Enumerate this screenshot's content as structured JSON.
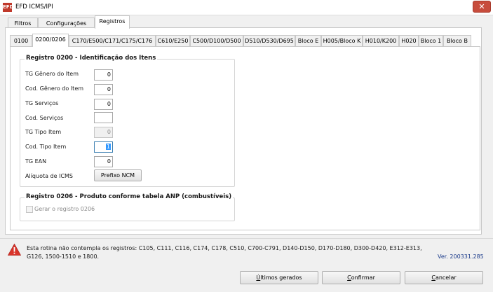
{
  "window": {
    "app_icon_text": "EFD",
    "title": "EFD ICMS/IPI",
    "close_glyph": "✕"
  },
  "top_tabs": [
    {
      "label": "Filtros",
      "active": false
    },
    {
      "label": "Configurações",
      "active": false
    },
    {
      "label": "Registros",
      "active": true
    }
  ],
  "inner_tabs": [
    {
      "label": "0100",
      "active": false
    },
    {
      "label": "0200/0206",
      "active": true
    },
    {
      "label": "C170/E500/C171/C175/C176",
      "active": false
    },
    {
      "label": "C610/E250",
      "active": false
    },
    {
      "label": "C500/D100/D500",
      "active": false
    },
    {
      "label": "D510/D530/D695",
      "active": false
    },
    {
      "label": "Bloco E",
      "active": false
    },
    {
      "label": "H005/Bloco K",
      "active": false
    },
    {
      "label": "H010/K200",
      "active": false
    },
    {
      "label": "H020",
      "active": false
    },
    {
      "label": "Bloco 1",
      "active": false
    },
    {
      "label": "Bloco B",
      "active": false
    }
  ],
  "group_0200": {
    "title": "Registro 0200 - Identificação dos Itens",
    "fields": [
      {
        "label": "TG Gênero do Item",
        "value": "0",
        "state": "normal"
      },
      {
        "label": "Cod. Gênero do Item",
        "value": "0",
        "state": "normal"
      },
      {
        "label": "TG Serviços",
        "value": "0",
        "state": "normal"
      },
      {
        "label": "Cod. Serviços",
        "value": "",
        "state": "normal"
      },
      {
        "label": "TG Tipo Item",
        "value": "0",
        "state": "disabled"
      },
      {
        "label": "Cod. Tipo Item",
        "value": "1",
        "state": "focused"
      },
      {
        "label": "TG EAN",
        "value": "0",
        "state": "normal"
      }
    ],
    "aliquota_label": "Alíquota de ICMS",
    "prefixo_button": "Prefixo NCM"
  },
  "group_0206": {
    "title": "Registro 0206 - Produto conforme tabela ANP (combustíveis)",
    "checkbox_label": "Gerar o registro 0206",
    "checkbox_checked": false,
    "checkbox_enabled": false
  },
  "footer": {
    "warning_line1": "Esta rotina não contempla os registros: C105, C111, C116, C174, C178, C510, C700-C791, D140-D150, D170-D180, D300-D420, E312-E313,",
    "warning_line2": "G126, 1500-1510 e 1800.",
    "version": "Ver. 200331.285",
    "buttons": {
      "ultimos_prefix": "Ú",
      "ultimos_rest": "ltimos gerados",
      "confirmar_prefix": "C",
      "confirmar_rest": "onfirmar",
      "cancelar_prefix": "C",
      "cancelar_rest": "ancelar"
    }
  },
  "colors": {
    "close_button": "#c74c3c",
    "warning_icon": "#d9342b",
    "version_text": "#1a3a8a",
    "focus_selection": "#3399ff"
  },
  "icons": {
    "app": "efd-app-icon",
    "close": "close-icon",
    "warning": "warning-triangle-icon"
  }
}
